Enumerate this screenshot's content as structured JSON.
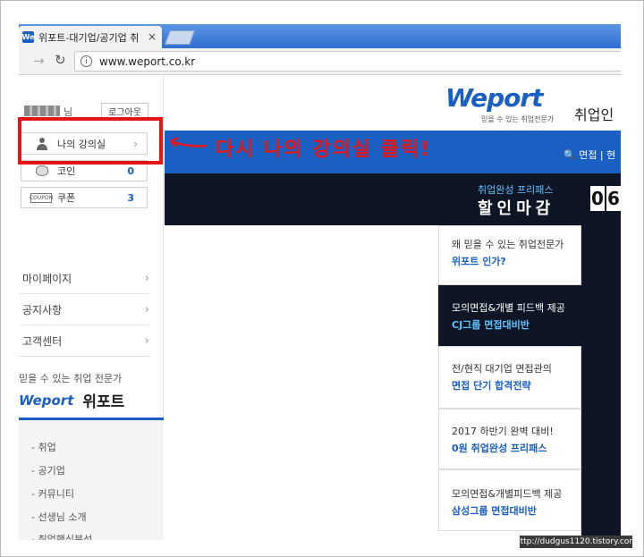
{
  "browser": {
    "tab_title": "위포트-대기업/공기업 취",
    "favicon_text": "We",
    "close_glyph": "×",
    "url": "www.weport.co.kr"
  },
  "sidebar": {
    "user_suffix": "님",
    "logout_label": "로그아웃",
    "my_lecture_label": "나의 강의실",
    "coin_label": "코인",
    "coin_count": "0",
    "coupon_label": "쿠폰",
    "coupon_count": "3",
    "coupon_icon_text": "COUPON",
    "menu": [
      {
        "label": "마이페이지"
      },
      {
        "label": "공지사항"
      },
      {
        "label": "고객센터"
      }
    ],
    "tagline": "믿을 수 있는 취업 전문가",
    "brand_logo": "Weport",
    "brand_name": "위포트",
    "sub_menu": [
      {
        "label": "- 취업"
      },
      {
        "label": "- 공기업"
      },
      {
        "label": "- 커뮤니티"
      },
      {
        "label": "- 선생님 소개"
      },
      {
        "label": "- 취업핵심분석"
      }
    ]
  },
  "header": {
    "logo": "Weport",
    "logo_tagline": "믿을 수 있는 취업전문가",
    "title_partial": "취업인",
    "search_text": "🔍 면접 | 현"
  },
  "promo": {
    "sub": "취업완성 프리패스",
    "main": "할인마감",
    "digits": [
      "0",
      "6"
    ]
  },
  "cards": [
    {
      "line1": "왜 믿을 수 있는 취업전문가",
      "line2": "위포트 인가?"
    },
    {
      "line1": "모의면접&개별 피드백 제공",
      "line2": "CJ그룹 면접대비반"
    },
    {
      "line1": "전/현직 대기업 면접관의",
      "line2": "면접 단기 합격전략"
    },
    {
      "line1": "2017 하반기 완벽 대비!",
      "line2": "0원 취업완성 프리패스"
    },
    {
      "line1": "모의면접&개별피드백 제공",
      "line2": "삼성그룹 면접대비반"
    }
  ],
  "annotation": {
    "text": "다시 나의 강의실 클릭!",
    "color": "#e51515"
  },
  "watermark": "http://dudgus1120.tistory.com",
  "colors": {
    "brand_blue": "#1a5fc2",
    "dark_navy": "#0e1524",
    "accent_cyan": "#5ec2ff"
  }
}
